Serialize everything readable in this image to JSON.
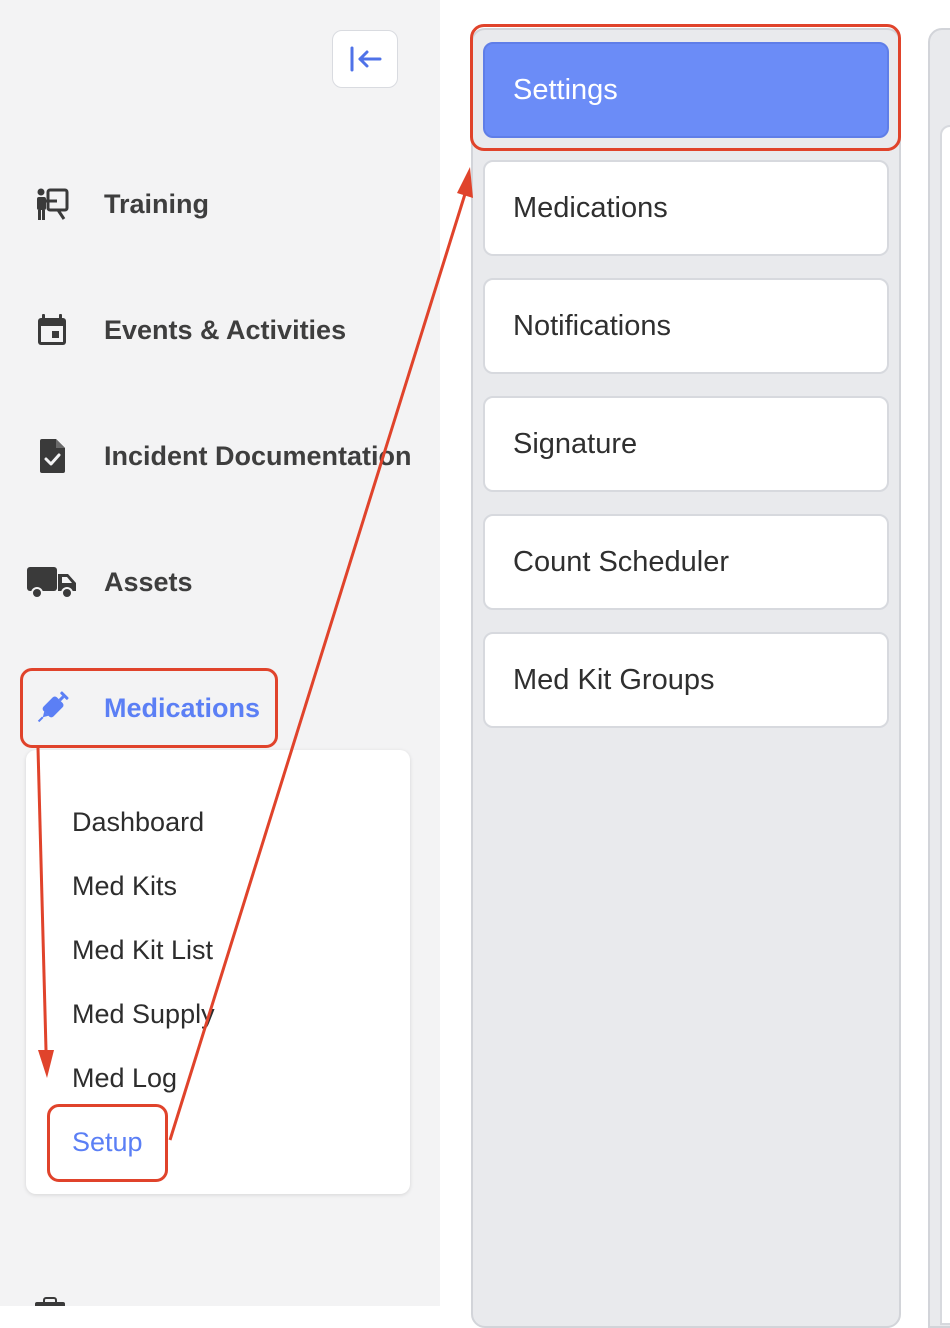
{
  "sidebar": {
    "collapse_icon": "collapse-left-icon",
    "items": [
      {
        "label": "Training",
        "icon": "training-presentation-icon"
      },
      {
        "label": "Events & Activities",
        "icon": "calendar-icon"
      },
      {
        "label": "Incident Documentation",
        "icon": "document-check-icon"
      },
      {
        "label": "Assets",
        "icon": "truck-icon"
      },
      {
        "label": "Medications",
        "icon": "syringe-icon",
        "active": true
      }
    ],
    "submenu": [
      {
        "label": "Dashboard"
      },
      {
        "label": "Med Kits"
      },
      {
        "label": "Med Kit List"
      },
      {
        "label": "Med Supply"
      },
      {
        "label": "Med Log"
      },
      {
        "label": "Setup",
        "active": true
      }
    ]
  },
  "setup_menu": {
    "items": [
      {
        "label": "Settings",
        "active": true
      },
      {
        "label": "Medications"
      },
      {
        "label": "Notifications"
      },
      {
        "label": "Signature"
      },
      {
        "label": "Count Scheduler"
      },
      {
        "label": "Med Kit Groups"
      }
    ]
  },
  "colors": {
    "accent": "#5b7ff5",
    "active_button": "#6b8cf7",
    "annotation": "#e0432b",
    "sidebar_bg": "#f3f3f4",
    "panel_bg": "#e9eaed"
  }
}
